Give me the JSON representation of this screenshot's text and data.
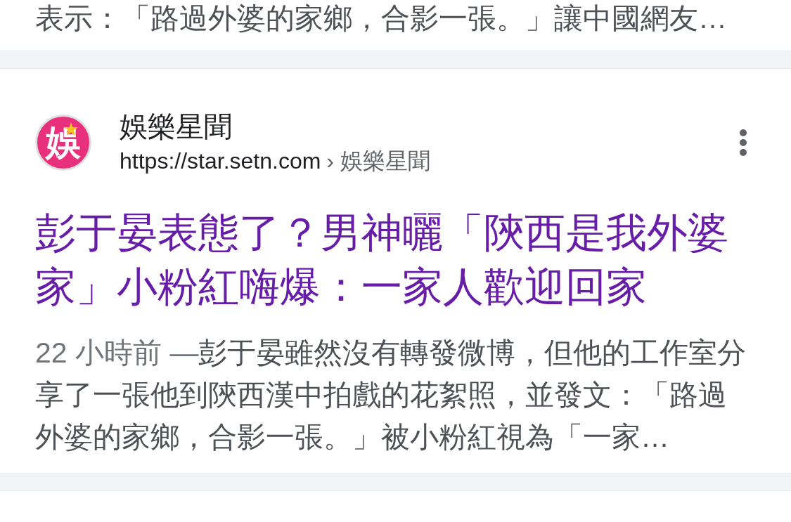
{
  "previous_result": {
    "snippet": "表示：「路過外婆的家鄉，合影一張。」讓中國網友…"
  },
  "result": {
    "logo_text": "娛",
    "site_name": "娛樂星聞",
    "url": "https://star.setn.com",
    "breadcrumb_separator": "›",
    "breadcrumb": "娛樂星聞",
    "title": "彭于晏表態了？男神曬「陝西是我外婆家」小粉紅嗨爆：一家人歡迎回家",
    "date": "22 小時前",
    "date_separator": "—",
    "snippet": "彭于晏雖然沒有轉發微博，但他的工作室分享了一張他到陝西漢中拍戲的花絮照，並發文：「路過外婆的家鄉，合影一張。」被小粉紅視為「一家…"
  }
}
